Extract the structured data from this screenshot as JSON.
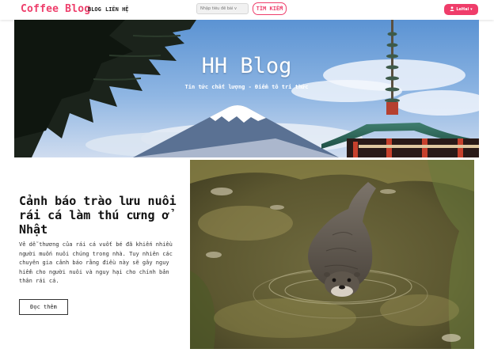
{
  "navbar": {
    "brand": "Coffee Blog",
    "links": [
      "BLOG",
      "LIÊN HỆ"
    ],
    "search_placeholder": "Nhập tiêu đề bài v",
    "search_button": "TÌM KIẾM",
    "user_label": "LeHai",
    "user_caret": "▾",
    "user_icon": "user-icon",
    "accent_color": "#ee3e6b"
  },
  "hero": {
    "title": "HH Blog",
    "subtitle": "Tin tức chất lượng - Điểm tô tri thức",
    "image": "mount-fuji-pagoda-landscape"
  },
  "post": {
    "title": "Cảnh báo trào lưu nuôi rái cá làm thú cưng ở Nhật",
    "excerpt": "Vẻ dễ thương của rái cá vuốt bé đã khiến nhiều người muốn nuôi chúng trong nhà. Tuy nhiên các chuyên gia cảnh báo rằng điều này sẽ gây nguy hiểm cho người nuôi và nguy hại cho chính bản thân rái cá.",
    "read_more": "Đọc thêm",
    "image": "otter-swimming-photo"
  }
}
